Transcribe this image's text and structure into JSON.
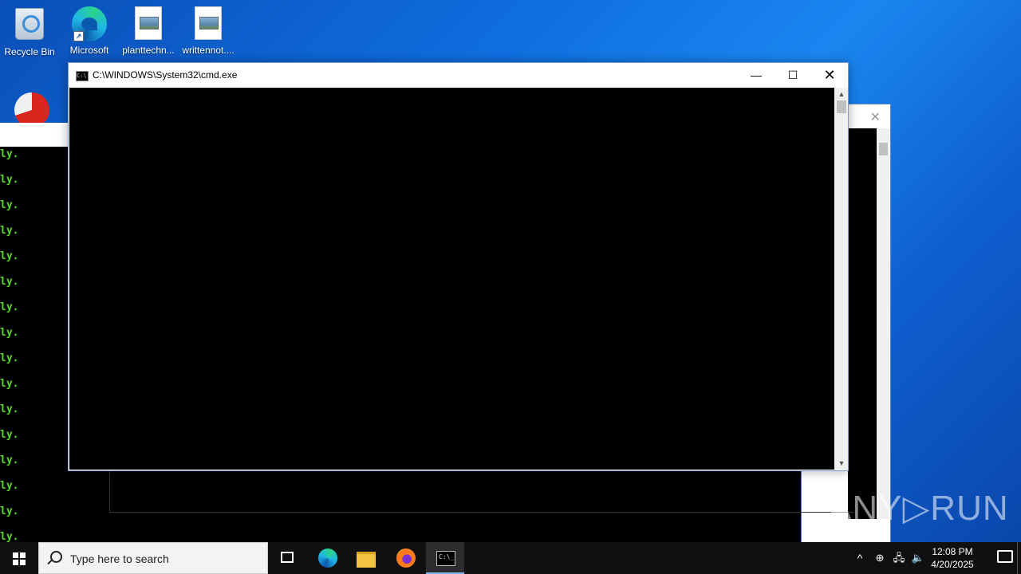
{
  "desktop": {
    "icons": [
      {
        "label": "Recycle Bin"
      },
      {
        "label": "Microsoft"
      },
      {
        "label": "planttechn..."
      },
      {
        "label": "writtennot...."
      }
    ]
  },
  "background_console": {
    "line_text": "ly.",
    "text_color": "#5bd434"
  },
  "cmd_window": {
    "title": "C:\\WINDOWS\\System32\\cmd.exe",
    "icon_text": "C:\\",
    "minimize_glyph": "—",
    "maximize_glyph": "☐",
    "close_glyph": "✕",
    "scroll_up": "▲",
    "scroll_down": "▼"
  },
  "second_window": {
    "close_glyph": "✕"
  },
  "watermark": "ANY▷RUN",
  "taskbar": {
    "search_placeholder": "Type here to search",
    "cmd_icon_text": "C:\\_",
    "clock_time": "12:08 PM",
    "clock_date": "4/20/2025",
    "tray_chevron": "^"
  }
}
